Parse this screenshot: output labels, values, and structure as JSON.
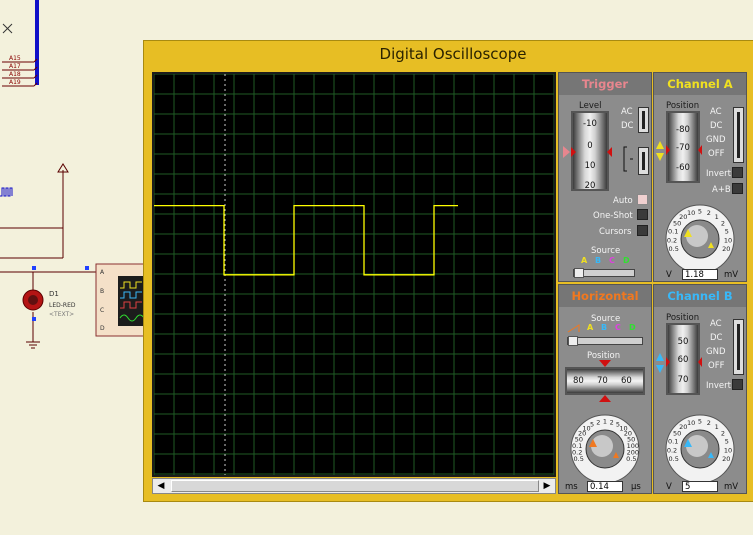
{
  "schematic": {
    "bus_labels": [
      "A15",
      "A17",
      "A18",
      "A19"
    ],
    "component_ref": "D1",
    "component_type": "LED-RED",
    "component_text": "<TEXT>",
    "instrument_pins": [
      "A",
      "B",
      "C",
      "D"
    ]
  },
  "scope": {
    "title": "Digital Oscilloscope",
    "waveform_color": "#ffff00",
    "waveform": [
      [
        0,
        1.48
      ],
      [
        0.7,
        1.48
      ],
      [
        0.7,
        1.1
      ],
      [
        1.4,
        1.1
      ],
      [
        1.4,
        1.48
      ],
      [
        2.1,
        1.48
      ],
      [
        2.1,
        1.1
      ],
      [
        2.8,
        1.1
      ],
      [
        2.8,
        1.48
      ],
      [
        3.04,
        1.48
      ]
    ]
  },
  "trigger": {
    "title": "Trigger",
    "level_label": "Level",
    "level_ticks": [
      "-10",
      "0",
      "10",
      "20"
    ],
    "ac": "AC",
    "dc": "DC",
    "auto": "Auto",
    "one_shot": "One-Shot",
    "cursors": "Cursors",
    "source_label": "Source",
    "sources": [
      "A",
      "B",
      "C",
      "D"
    ]
  },
  "channel_a": {
    "title": "Channel A",
    "position_label": "Position",
    "position_ticks": [
      "-80",
      "-70",
      "-60"
    ],
    "ac": "AC",
    "dc": "DC",
    "gnd": "GND",
    "off": "OFF",
    "invert": "Invert",
    "a_plus_b": "A+B",
    "dial_ticks": [
      "0.5",
      "0.2",
      "0.1",
      "50",
      "20",
      "10",
      "5",
      "2",
      "1",
      "2",
      "5",
      "10",
      "20"
    ],
    "unit_left": "V",
    "unit_right": "mV",
    "value": "1.18"
  },
  "horizontal": {
    "title": "Horizontal",
    "source_label": "Source",
    "sources": [
      "A",
      "B",
      "C",
      "D"
    ],
    "position_label": "Position",
    "position_ticks": [
      "80",
      "70",
      "60"
    ],
    "dial_ticks": [
      "0.5",
      "0.2",
      "0.1",
      "50",
      "20",
      "10",
      "5",
      "2",
      "1",
      "2",
      "5",
      "10",
      "20",
      "50",
      "100",
      "200",
      "0.5"
    ],
    "unit_left": "ms",
    "unit_right": "µs",
    "value": "0.14"
  },
  "channel_b": {
    "title": "Channel B",
    "position_label": "Position",
    "position_ticks": [
      "50",
      "60",
      "70"
    ],
    "ac": "AC",
    "dc": "DC",
    "gnd": "GND",
    "off": "OFF",
    "invert": "Invert",
    "dial_ticks": [
      "0.5",
      "0.2",
      "0.1",
      "50",
      "20",
      "10",
      "5",
      "2",
      "1",
      "2",
      "5",
      "10",
      "20"
    ],
    "unit_left": "V",
    "unit_right": "mV",
    "value": "5"
  },
  "colors": {
    "trigger": "#e8868e",
    "channel_a": "#f0e020",
    "horizontal": "#f07820",
    "channel_b": "#38b8f8",
    "src_a": "#f0e020",
    "src_b": "#38b8f8",
    "src_c": "#e040e0",
    "src_d": "#30e030"
  }
}
